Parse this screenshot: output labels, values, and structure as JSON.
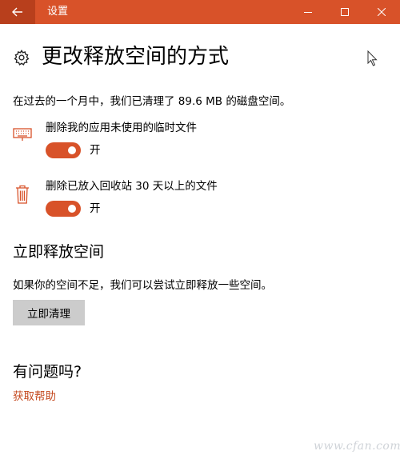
{
  "window": {
    "title": "设置"
  },
  "page": {
    "title": "更改释放空间的方式",
    "summary": "在过去的一个月中，我们已清理了 89.6 MB 的磁盘空间。"
  },
  "settings": [
    {
      "label": "删除我的应用未使用的临时文件",
      "state": "开",
      "on": true
    },
    {
      "label": "删除已放入回收站 30 天以上的文件",
      "state": "开",
      "on": true
    }
  ],
  "free_now": {
    "heading": "立即释放空间",
    "description": "如果你的空间不足，我们可以尝试立即释放一些空间。",
    "button_label": "立即清理"
  },
  "help": {
    "heading": "有问题吗?",
    "link_label": "获取帮助"
  },
  "watermark": "www.cfan.com.cn",
  "colors": {
    "accent": "#d85229",
    "titlebar_back": "#b83f1c",
    "link": "#c4491f",
    "button_bg": "#cccccc"
  }
}
